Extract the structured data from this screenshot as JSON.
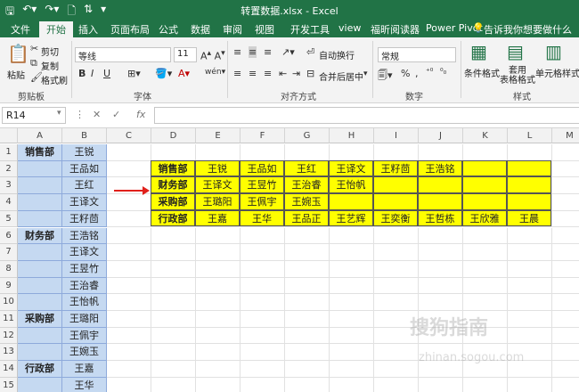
{
  "titlebar": {
    "title": "转置数据.xlsx - Excel",
    "save_icon": "save-icon",
    "undo_icon": "undo-icon",
    "redo_icon": "redo-icon"
  },
  "tabs": [
    "文件",
    "开始",
    "插入",
    "页面布局",
    "公式",
    "数据",
    "审阅",
    "视图",
    "开发工具",
    "view",
    "福昕阅读器",
    "Power Pivot"
  ],
  "active_tab": "开始",
  "tell_me": "告诉我你想要做什么",
  "ribbon": {
    "clipboard": {
      "label": "剪贴板",
      "paste": "粘贴",
      "cut": "剪切",
      "copy": "复制",
      "format_painter": "格式刷"
    },
    "font": {
      "label": "字体",
      "font_name": "等线",
      "font_size": "11",
      "bold": "B",
      "italic": "I",
      "underline": "U"
    },
    "alignment": {
      "label": "对齐方式",
      "wrap": "自动换行",
      "merge": "合并后居中"
    },
    "number": {
      "label": "数字",
      "format": "常规"
    },
    "styles": {
      "label": "样式",
      "conditional": "条件格式",
      "table": "套用\n表格格式",
      "cell_styles": "单元格样式"
    }
  },
  "formula_bar": {
    "name_box": "R14",
    "fx": "fx",
    "formula": ""
  },
  "columns": [
    "A",
    "B",
    "C",
    "D",
    "E",
    "F",
    "G",
    "H",
    "I",
    "J",
    "K",
    "L",
    "M"
  ],
  "rows": [
    "1",
    "2",
    "3",
    "4",
    "5",
    "6",
    "7",
    "8",
    "9",
    "10",
    "11",
    "12",
    "13",
    "14",
    "15",
    "16"
  ],
  "source": {
    "A": [
      {
        "row": 1,
        "text": "销售部"
      },
      {
        "row": 6,
        "text": "财务部"
      },
      {
        "row": 11,
        "text": "采购部"
      },
      {
        "row": 14,
        "text": "行政部"
      }
    ],
    "B": [
      "王锐",
      "王品如",
      "王红",
      "王译文",
      "王籽茴",
      "王浩铭",
      "王译文",
      "王昱竹",
      "王治睿",
      "王怡帆",
      "王璐阳",
      "王佩宇",
      "王婉玉",
      "王嘉",
      "王华",
      "王品正"
    ]
  },
  "result": [
    [
      "销售部",
      "王锐",
      "王品如",
      "王红",
      "王译文",
      "王籽茴",
      "王浩铭",
      "",
      ""
    ],
    [
      "财务部",
      "王译文",
      "王昱竹",
      "王治睿",
      "王怡帆",
      "",
      "",
      "",
      ""
    ],
    [
      "采购部",
      "王璐阳",
      "王佩宇",
      "王婉玉",
      "",
      "",
      "",
      "",
      ""
    ],
    [
      "行政部",
      "王嘉",
      "王华",
      "王品正",
      "王艺辉",
      "王奕衡",
      "王哲栋",
      "王欣雅",
      "王晨"
    ]
  ],
  "watermark": "搜狗指南",
  "watermark_url": "zhinan.sogou.com"
}
